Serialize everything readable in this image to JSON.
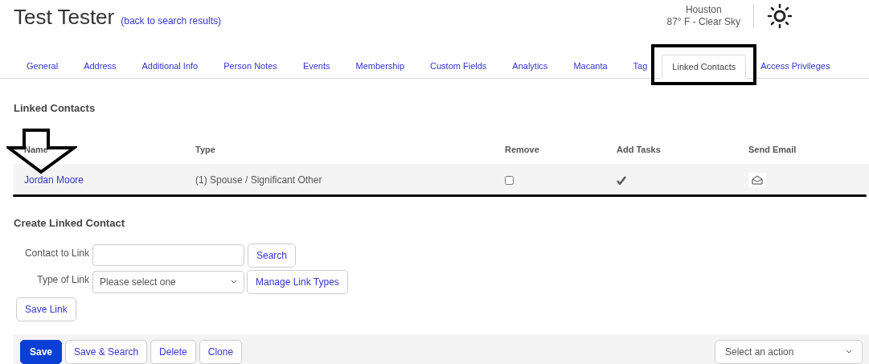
{
  "header": {
    "title": "Test Tester",
    "back_link": "(back to search results)"
  },
  "weather": {
    "city": "Houston",
    "conditions": "87° F - Clear Sky"
  },
  "tabs": [
    {
      "label": "General",
      "selected": false
    },
    {
      "label": "Address",
      "selected": false
    },
    {
      "label": "Additional Info",
      "selected": false
    },
    {
      "label": "Person Notes",
      "selected": false
    },
    {
      "label": "Events",
      "selected": false
    },
    {
      "label": "Membership",
      "selected": false
    },
    {
      "label": "Custom Fields",
      "selected": false
    },
    {
      "label": "Analytics",
      "selected": false
    },
    {
      "label": "Macanta",
      "selected": false
    },
    {
      "label": "Tag",
      "selected": false
    },
    {
      "label": "Linked Contacts",
      "selected": true
    },
    {
      "label": "Access Privileges",
      "selected": false
    }
  ],
  "linked_contacts": {
    "heading": "Linked Contacts",
    "columns": [
      "Name",
      "Type",
      "Remove",
      "Add Tasks",
      "Send Email"
    ],
    "rows": [
      {
        "name": "Jordan Moore",
        "type": "(1) Spouse / Significant Other",
        "remove": false,
        "add_tasks": true
      }
    ]
  },
  "create_form": {
    "heading": "Create Linked Contact",
    "contact_label": "Contact to Link",
    "search_button": "Search",
    "type_label": "Type of Link",
    "type_select": "Please select one",
    "manage_button": "Manage Link Types",
    "save_button": "Save Link"
  },
  "footer": {
    "buttons": [
      {
        "label": "Save",
        "kind": "primary"
      },
      {
        "label": "Save & Search",
        "kind": "secondary"
      },
      {
        "label": "Delete",
        "kind": "secondary"
      },
      {
        "label": "Clone",
        "kind": "secondary"
      }
    ],
    "action_select": "Select an action"
  }
}
